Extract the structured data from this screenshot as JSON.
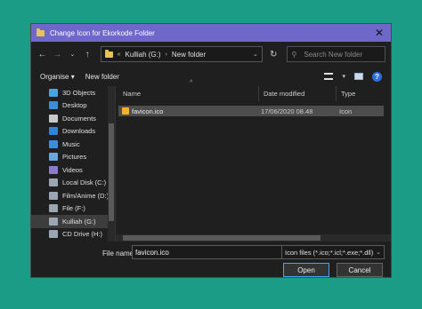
{
  "window": {
    "title": "Change Icon for Ekorkode Folder"
  },
  "address": {
    "prefix": "«",
    "crumbs": [
      "Kulliah (G:)",
      "New folder"
    ],
    "search_placeholder": "Search New folder"
  },
  "toolbar": {
    "organise": "Organise",
    "organise_caret": "▾",
    "new_folder": "New folder"
  },
  "nav": {
    "items": [
      {
        "label": "3D Objects",
        "icon": "cube-icon",
        "color": "#4aa3df"
      },
      {
        "label": "Desktop",
        "icon": "desktop-icon",
        "color": "#3b8fd8"
      },
      {
        "label": "Documents",
        "icon": "documents-icon",
        "color": "#c9c9c9"
      },
      {
        "label": "Downloads",
        "icon": "download-icon",
        "color": "#2f86d8"
      },
      {
        "label": "Music",
        "icon": "music-icon",
        "color": "#3b8fd8"
      },
      {
        "label": "Pictures",
        "icon": "pictures-icon",
        "color": "#6aa6d9"
      },
      {
        "label": "Videos",
        "icon": "videos-icon",
        "color": "#8b7ad0"
      },
      {
        "label": "Local Disk (C:)",
        "icon": "drive-icon",
        "color": "#9aa7b3"
      },
      {
        "label": "Film/Anime (D:)",
        "icon": "drive-icon",
        "color": "#9aa7b3"
      },
      {
        "label": "File (F:)",
        "icon": "drive-icon",
        "color": "#9aa7b3"
      },
      {
        "label": "Kulliah (G:)",
        "icon": "drive-icon",
        "color": "#9aa7b3",
        "selected": true
      },
      {
        "label": "CD Drive (H:)",
        "icon": "cd-drive-icon",
        "color": "#9aa7b3"
      }
    ]
  },
  "columns": {
    "name": "Name",
    "date": "Date modified",
    "type": "Type"
  },
  "files": [
    {
      "name": "favicon.ico",
      "date": "17/06/2020 08.48",
      "type": "Icon"
    }
  ],
  "footer": {
    "file_name_label": "File name:",
    "file_name_value": "favicon.ico",
    "filter_value": "Icon files (*.ico;*.icl;*.exe;*.dll)",
    "open": "Open",
    "cancel": "Cancel"
  },
  "colors": {
    "background": "#1b9c86",
    "titlebar": "#6f67c9",
    "dialog": "#1f1f1f",
    "selection": "#4d4d4d"
  }
}
